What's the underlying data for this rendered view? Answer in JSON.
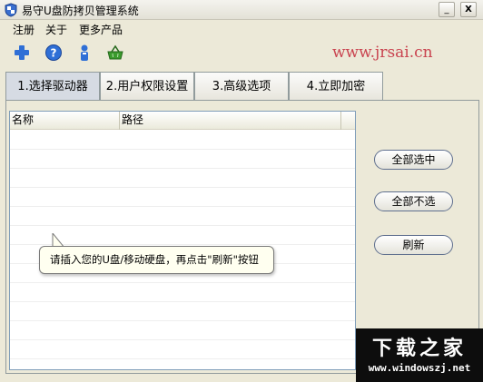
{
  "window": {
    "title": "易守U盘防拷贝管理系统",
    "minimize_glyph": "_",
    "close_glyph": "X"
  },
  "menu": {
    "items": [
      "注册",
      "关于",
      "更多产品"
    ]
  },
  "toolbar": {
    "icons": [
      "plus-icon",
      "help-icon",
      "user-icon",
      "basket-icon"
    ],
    "watermark": "www.jrsai.cn"
  },
  "tabs": [
    {
      "label": "1.选择驱动器",
      "active": true
    },
    {
      "label": "2.用户权限设置",
      "active": false
    },
    {
      "label": "3.高级选项",
      "active": false
    },
    {
      "label": "4.立即加密",
      "active": false
    }
  ],
  "drive_list": {
    "columns": [
      "名称",
      "路径"
    ],
    "rows": []
  },
  "buttons": {
    "select_all": "全部选中",
    "select_none": "全部不选",
    "refresh": "刷新"
  },
  "tooltip": {
    "text": "请插入您的U盘/移动硬盘，再点击\"刷新\"按钮"
  },
  "logo": {
    "main": "下载之家",
    "sub": "www.windowszj.net"
  },
  "colors": {
    "watermark": "#c9434f",
    "icon_blue": "#2f6fd6",
    "icon_green": "#3a9a2c"
  }
}
